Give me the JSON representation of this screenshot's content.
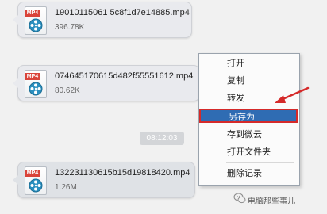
{
  "messages": [
    {
      "badge": "MP4",
      "filename": "19010115061 5c8f1d7e14885.mp4",
      "size": "396.78K"
    },
    {
      "badge": "MP4",
      "filename": "074645170615d482f55551612.mp4",
      "size": "80.62K"
    },
    {
      "badge": "MP4",
      "filename": "132231130615b15d19818420.mp4",
      "size": "1.26M"
    }
  ],
  "timestamp": "08:12:03",
  "context_menu": {
    "items": [
      "打开",
      "复制",
      "转发",
      "另存为",
      "存到微云",
      "打开文件夹",
      "删除记录"
    ],
    "highlighted": "另存为"
  },
  "watermark": "电脑那些事儿",
  "colors": {
    "highlight": "#2f6cb3",
    "annotation_red": "#d52a2a",
    "badge_red": "#d9443a"
  },
  "icons": [
    "mp4-file-icon",
    "film-reel-icon",
    "wechat-icon"
  ]
}
